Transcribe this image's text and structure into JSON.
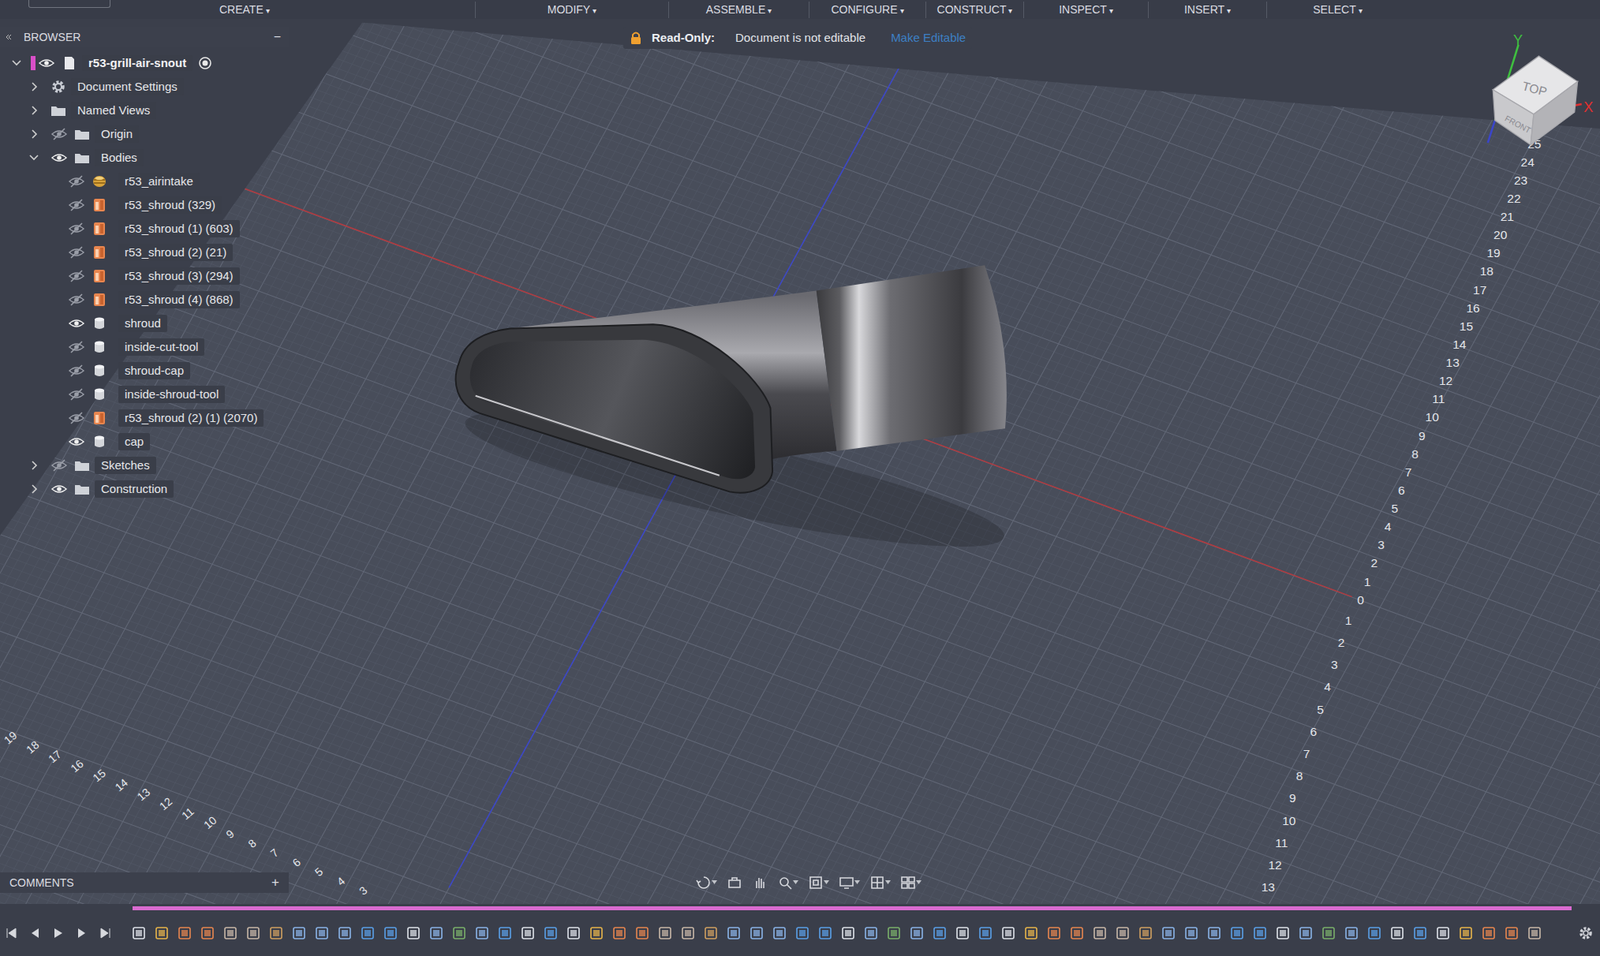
{
  "toolbar": {
    "menus": [
      {
        "label": "CREATE",
        "caret": "▾"
      },
      {
        "label": "MODIFY",
        "caret": "▾"
      },
      {
        "label": "ASSEMBLE",
        "caret": "▾"
      },
      {
        "label": "CONFIGURE",
        "caret": "▾"
      },
      {
        "label": "CONSTRUCT",
        "caret": "▾"
      },
      {
        "label": "INSPECT",
        "caret": "▾"
      },
      {
        "label": "INSERT",
        "caret": "▾"
      },
      {
        "label": "SELECT",
        "caret": "▾"
      }
    ]
  },
  "banner": {
    "label": "Read-Only:",
    "message": "Document is not editable",
    "action": "Make Editable"
  },
  "browser": {
    "title": "BROWSER",
    "collapse": "−",
    "root": {
      "name": "r53-grill-air-snout",
      "expanded": true,
      "visible": true,
      "active": true
    },
    "folders": [
      {
        "name": "Document Settings",
        "kind": "settings",
        "has_eye": false,
        "visible": false,
        "expanded": false,
        "children": []
      },
      {
        "name": "Named Views",
        "kind": "folder",
        "has_eye": false,
        "visible": false,
        "expanded": false,
        "children": []
      },
      {
        "name": "Origin",
        "kind": "folder",
        "has_eye": true,
        "visible": false,
        "expanded": false,
        "children": []
      },
      {
        "name": "Bodies",
        "kind": "folder",
        "has_eye": true,
        "visible": true,
        "expanded": true,
        "children": [
          {
            "name": "r53_airintake",
            "kind": "mesh",
            "visible": false
          },
          {
            "name": "r53_shroud (329)",
            "kind": "component",
            "visible": false
          },
          {
            "name": "r53_shroud (1) (603)",
            "kind": "component",
            "visible": false
          },
          {
            "name": "r53_shroud (2) (21)",
            "kind": "component",
            "visible": false
          },
          {
            "name": "r53_shroud (3) (294)",
            "kind": "component",
            "visible": false
          },
          {
            "name": "r53_shroud (4) (868)",
            "kind": "component",
            "visible": false
          },
          {
            "name": "shroud",
            "kind": "body",
            "visible": true
          },
          {
            "name": "inside-cut-tool",
            "kind": "body",
            "visible": false
          },
          {
            "name": "shroud-cap",
            "kind": "body",
            "visible": false
          },
          {
            "name": "inside-shroud-tool",
            "kind": "body",
            "visible": false
          },
          {
            "name": "r53_shroud (2) (1) (2070)",
            "kind": "component",
            "visible": false
          },
          {
            "name": "cap",
            "kind": "body",
            "visible": true
          }
        ]
      },
      {
        "name": "Sketches",
        "kind": "folder",
        "has_eye": true,
        "visible": false,
        "expanded": false,
        "children": []
      },
      {
        "name": "Construction",
        "kind": "folder",
        "has_eye": true,
        "visible": true,
        "expanded": false,
        "children": []
      }
    ]
  },
  "comments": {
    "title": "COMMENTS",
    "add": "+"
  },
  "viewcube": {
    "top": "TOP",
    "front": "FRONT",
    "axes": [
      {
        "label": "Y",
        "color": "#3fbf3f"
      },
      {
        "label": "X",
        "color": "#e03030"
      }
    ]
  },
  "rulers": {
    "right_upper": [
      "25",
      "24",
      "23",
      "22",
      "21",
      "20",
      "19",
      "18",
      "17",
      "16",
      "15",
      "14",
      "13",
      "12",
      "11",
      "10",
      "9",
      "8",
      "7",
      "6",
      "5",
      "4",
      "3",
      "2",
      "1",
      "0"
    ],
    "right_lower": [
      "1",
      "2",
      "3",
      "4",
      "5",
      "6",
      "7",
      "8",
      "9",
      "10",
      "11",
      "12",
      "13"
    ],
    "left": [
      "19",
      "18",
      "17",
      "16",
      "15",
      "14",
      "13",
      "12",
      "11",
      "10",
      "9",
      "8",
      "7",
      "6",
      "5",
      "4",
      "3"
    ]
  }
}
